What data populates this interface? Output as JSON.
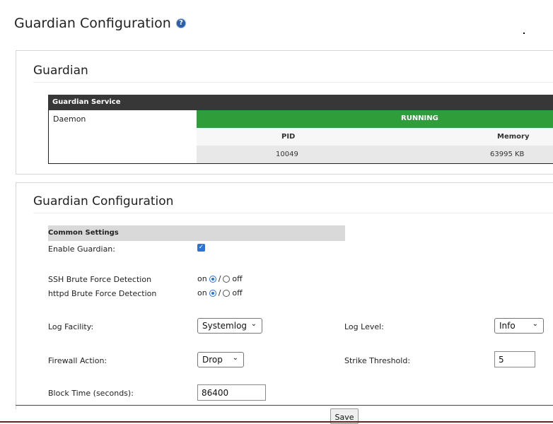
{
  "page": {
    "title": "Guardian Configuration"
  },
  "guardian_panel": {
    "title": "Guardian",
    "service_table": {
      "header": "Guardian Service",
      "row_label": "Daemon",
      "status": "RUNNING",
      "columns": [
        "PID",
        "Memory"
      ],
      "values": [
        "10049",
        "63995 KB"
      ]
    }
  },
  "config_panel": {
    "title": "Guardian Configuration",
    "section_header": "Common Settings",
    "enable_label": "Enable Guardian:",
    "enable_checked": true,
    "ssh_label": "SSH Brute Force Detection",
    "httpd_label": "httpd Brute Force Detection",
    "radio_on": "on",
    "radio_sep": "/",
    "radio_off": "off",
    "log_facility_label": "Log Facility:",
    "log_facility_value": "Systemlog",
    "log_level_label": "Log Level:",
    "log_level_value": "Info",
    "firewall_label": "Firewall Action:",
    "firewall_value": "Drop",
    "strike_label": "Strike Threshold:",
    "strike_value": "5",
    "block_label": "Block Time (seconds):",
    "block_value": "86400",
    "save_label": "Save"
  },
  "colors": {
    "running": "#2f9e3a",
    "accent": "#2a73d9",
    "header_dark": "#373737"
  }
}
